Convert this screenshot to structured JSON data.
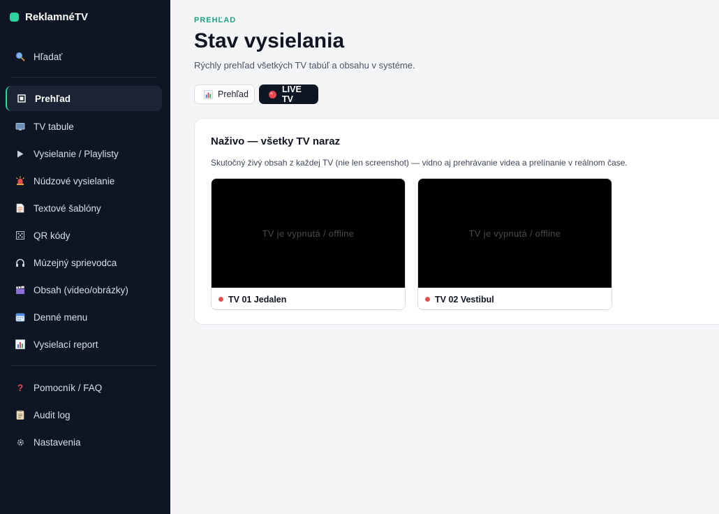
{
  "brand": {
    "name": "ReklamnéTV",
    "accent": "#2fd3a2"
  },
  "sidebar": {
    "search": {
      "label": "Hľadať",
      "icon": "search-icon"
    },
    "items": [
      {
        "label": "Prehľad",
        "icon": "overview-icon",
        "active": true
      },
      {
        "label": "TV tabule",
        "icon": "tv-icon"
      },
      {
        "label": "Vysielanie / Playlisty",
        "icon": "play-icon"
      },
      {
        "label": "Núdzové vysielanie",
        "icon": "siren-icon"
      },
      {
        "label": "Textové šablóny",
        "icon": "document-icon"
      },
      {
        "label": "QR kódy",
        "icon": "qr-icon"
      },
      {
        "label": "Múzejný sprievodca",
        "icon": "headphones-icon"
      },
      {
        "label": "Obsah (video/obrázky)",
        "icon": "clapper-icon"
      },
      {
        "label": "Denné menu",
        "icon": "calendar-icon"
      },
      {
        "label": "Vysielací report",
        "icon": "bar-chart-icon"
      }
    ],
    "bottom_items": [
      {
        "label": "Pomocník / FAQ",
        "icon": "question-icon"
      },
      {
        "label": "Audit log",
        "icon": "log-icon"
      },
      {
        "label": "Nastavenia",
        "icon": "gear-icon"
      }
    ]
  },
  "header": {
    "eyebrow": "PREHĽAD",
    "title": "Stav vysielania",
    "subtitle": "Rýchly prehľad všetkých TV tabúľ a obsahu v systéme."
  },
  "tabs": [
    {
      "label": "Prehľad",
      "icon": "bar-chart-icon",
      "active": false
    },
    {
      "label": "LIVE TV",
      "icon": "live-dot-icon",
      "active": true
    }
  ],
  "live_panel": {
    "title": "Naživo — všetky TV naraz",
    "description": "Skutočný živý obsah z každej TV (nie len screenshot) — vidno aj prehrávanie videa a prelínanie v reálnom čase.",
    "tvs": [
      {
        "name": "TV 01 Jedalen",
        "screen_text": "TV je vypnutá / offline",
        "status_color": "#e0524f"
      },
      {
        "name": "TV 02 Vestibul",
        "screen_text": "TV je vypnutá / offline",
        "status_color": "#e0524f"
      }
    ]
  }
}
